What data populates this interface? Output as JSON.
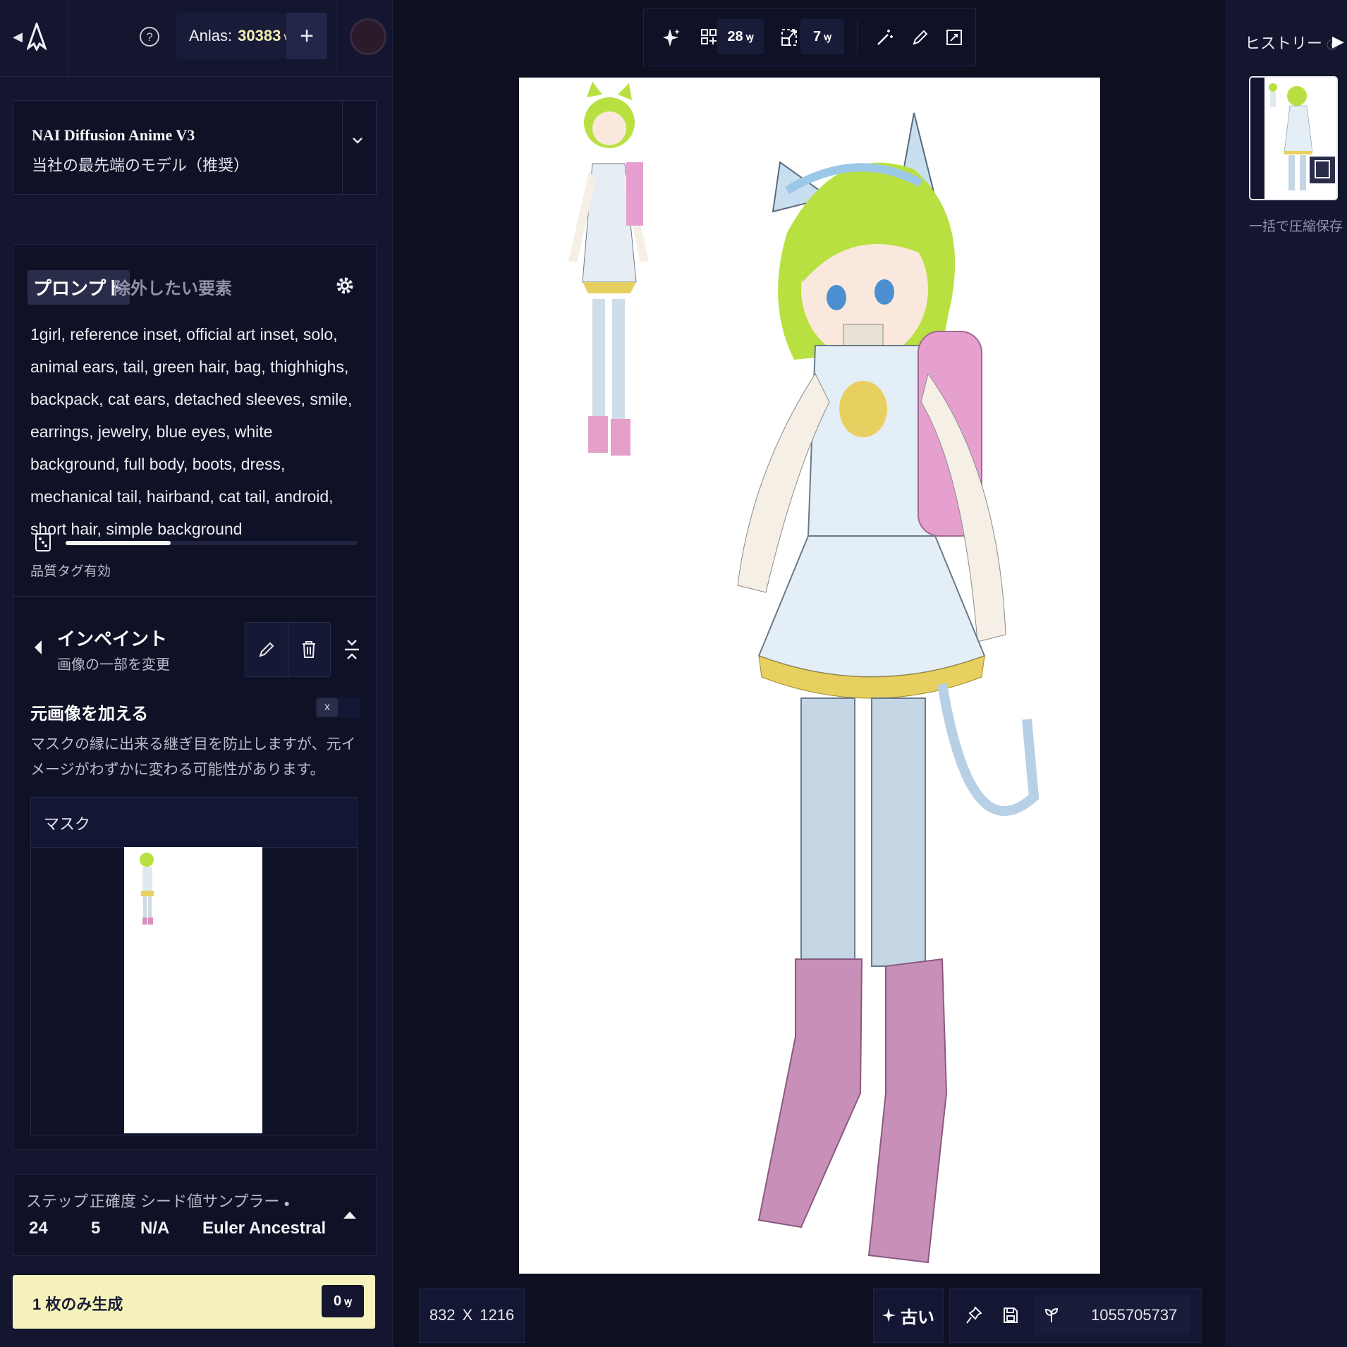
{
  "topbar": {
    "anlas_label": "Anlas:",
    "anlas_value": "30383",
    "add_label": "+"
  },
  "model": {
    "name": "NAI Diffusion Anime V3",
    "description": "当社の最先端のモデル（推奨）"
  },
  "prompt": {
    "tab_prompt": "プロンプト",
    "tab_negative": "除外したい要素",
    "text": "1girl, reference inset, official art inset, solo, animal ears, tail, green hair, bag, thighhighs, backpack, cat ears, detached sleeves, smile, earrings, jewelry, blue eyes, white background, full body, boots, dress, mechanical tail, hairband, cat tail, android, short hair, simple background",
    "quality_label": "品質タグ有効",
    "strength": 0.36
  },
  "inpaint": {
    "title": "インペイント",
    "subtitle": "画像の一部を変更",
    "orig_label": "元画像を加える",
    "orig_toggle": "x",
    "orig_desc": "マスクの縁に出来る継ぎ目を防止しますが、元イメージがわずかに変わる可能性があります。",
    "mask_label": "マスク"
  },
  "settings": {
    "steps_label": "ステップ",
    "steps_value": "24",
    "guidance_label": "正確度",
    "guidance_value": "5",
    "seed_label": "シード値",
    "seed_value": "N/A",
    "sampler_label": "サンプラー",
    "sampler_value": "Euler Ancestral"
  },
  "generate": {
    "label": "1 枚のみ生成",
    "cost": "0"
  },
  "toolbar": {
    "count_a": "28",
    "count_b": "7"
  },
  "image": {
    "width": "832",
    "times": "X",
    "height": "1216",
    "old_label": "古い",
    "seed": "1055705737"
  },
  "history": {
    "title": "ヒストリー",
    "save_all": "一括で圧縮保存"
  },
  "colors": {
    "background": "#0e1022",
    "panel": "#13162e",
    "accent": "#f5f2bc"
  }
}
